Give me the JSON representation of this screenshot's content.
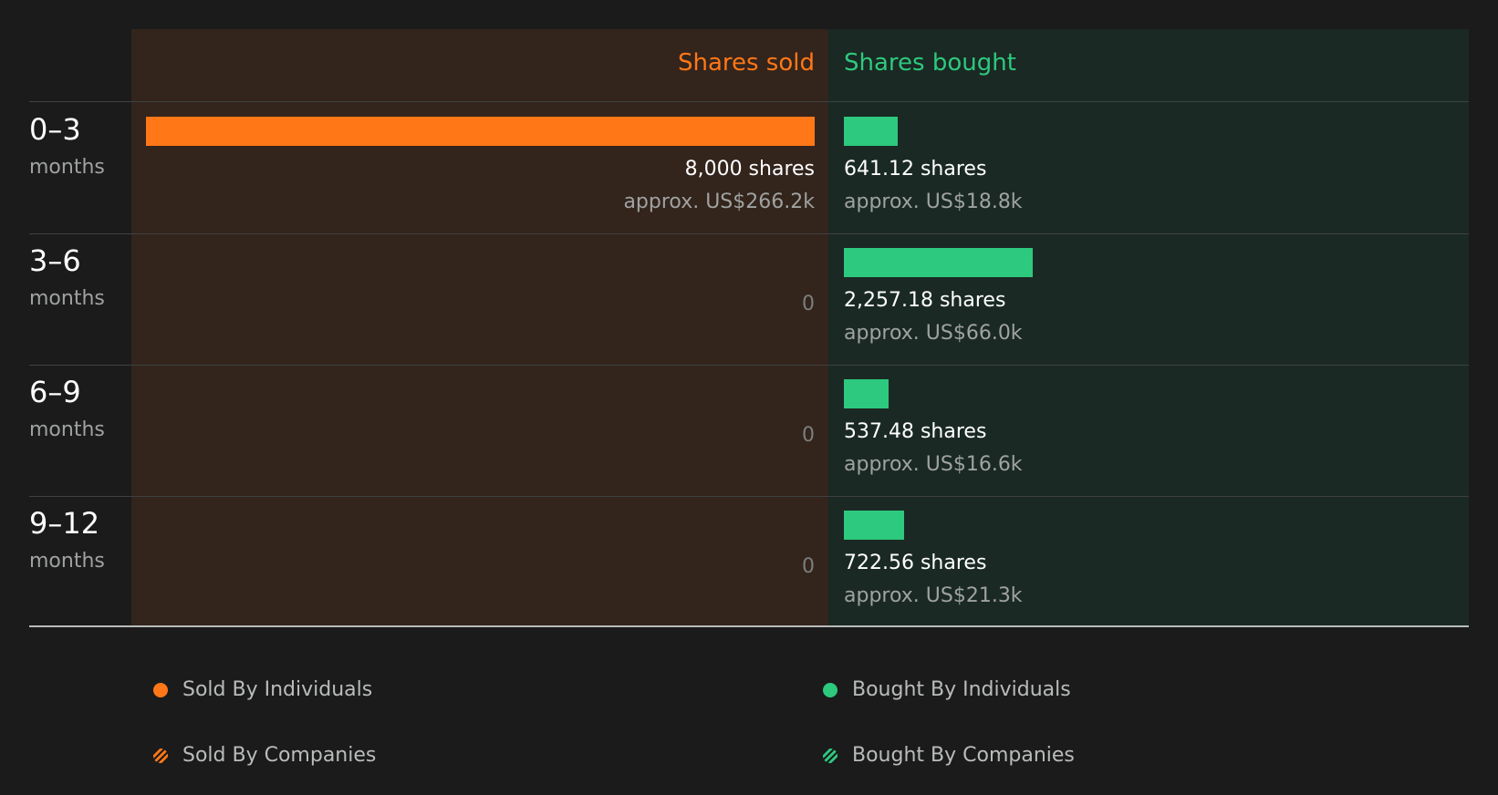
{
  "colors": {
    "sold": "#ff7717",
    "bought": "#2dc97e"
  },
  "chart_data": {
    "type": "bar",
    "categories": [
      "0–3",
      "3–6",
      "6–9",
      "9–12"
    ],
    "category_unit": "months",
    "series": [
      {
        "name": "Shares sold",
        "values": [
          8000,
          0,
          0,
          0
        ],
        "value_labels": [
          "8,000 shares",
          "0",
          "0",
          "0"
        ],
        "approx_values": [
          "approx. US$266.2k",
          "",
          "",
          ""
        ]
      },
      {
        "name": "Shares bought",
        "values": [
          641.12,
          2257.18,
          537.48,
          722.56
        ],
        "value_labels": [
          "641.12 shares",
          "2,257.18 shares",
          "537.48 shares",
          "722.56 shares"
        ],
        "approx_values": [
          "approx. US$18.8k",
          "approx. US$66.0k",
          "approx. US$16.6k",
          "approx. US$21.3k"
        ]
      }
    ],
    "xlim": [
      0,
      8000
    ],
    "legend": {
      "placement": "bottom",
      "items": [
        {
          "label": "Sold By Individuals",
          "icon": "solid-dot-icon",
          "color": "#ff7717"
        },
        {
          "label": "Bought By Individuals",
          "icon": "solid-dot-icon",
          "color": "#2dc97e"
        },
        {
          "label": "Sold By Companies",
          "icon": "striped-dot-icon",
          "color": "#ff7717"
        },
        {
          "label": "Bought By Companies",
          "icon": "striped-dot-icon",
          "color": "#2dc97e"
        }
      ]
    }
  }
}
